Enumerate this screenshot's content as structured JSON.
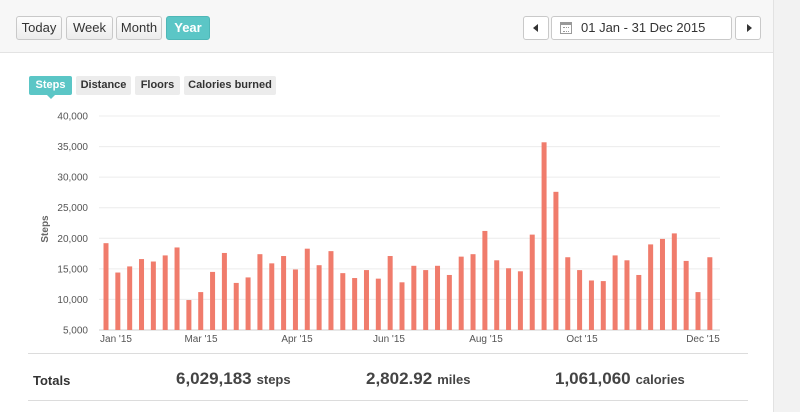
{
  "toolbar": {
    "ranges": [
      "Today",
      "Week",
      "Month",
      "Year"
    ],
    "active_range": "Year",
    "date_range": "01 Jan - 31 Dec 2015"
  },
  "metrics": {
    "tabs": [
      "Steps",
      "Distance",
      "Floors",
      "Calories burned"
    ],
    "active": "Steps"
  },
  "chart_data": {
    "type": "bar",
    "ylabel": "Steps",
    "xlabel": "",
    "ylim": [
      5000,
      40000
    ],
    "y_ticks": [
      "40,000",
      "35,000",
      "30,000",
      "25,000",
      "20,000",
      "15,000",
      "10,000",
      "5,000"
    ],
    "x_ticks": [
      "Jan '15",
      "Mar '15",
      "Apr '15",
      "Jun '15",
      "Aug '15",
      "Oct '15",
      "Dec '15"
    ],
    "bar_color": "#f07c6c",
    "grid": true,
    "values": [
      19200,
      14400,
      15400,
      16600,
      16200,
      17200,
      18500,
      9900,
      11200,
      14500,
      17600,
      12700,
      13600,
      17400,
      15900,
      17100,
      14900,
      18300,
      15600,
      17900,
      14300,
      13500,
      14800,
      13400,
      17100,
      12800,
      15500,
      14800,
      15500,
      14000,
      17000,
      17400,
      21200,
      16400,
      15100,
      14600,
      20600,
      35700,
      27600,
      16900,
      14800,
      13100,
      13000,
      17200,
      16400,
      14000,
      19000,
      19900,
      20800,
      16300,
      11200,
      16900
    ]
  },
  "totals": {
    "label": "Totals",
    "steps_value": "6,029,183",
    "steps_unit": "steps",
    "miles_value": "2,802.92",
    "miles_unit": "miles",
    "calories_value": "1,061,060",
    "calories_unit": "calories"
  },
  "colors": {
    "accent": "#5bc6c6",
    "bar": "#f07c6c"
  }
}
